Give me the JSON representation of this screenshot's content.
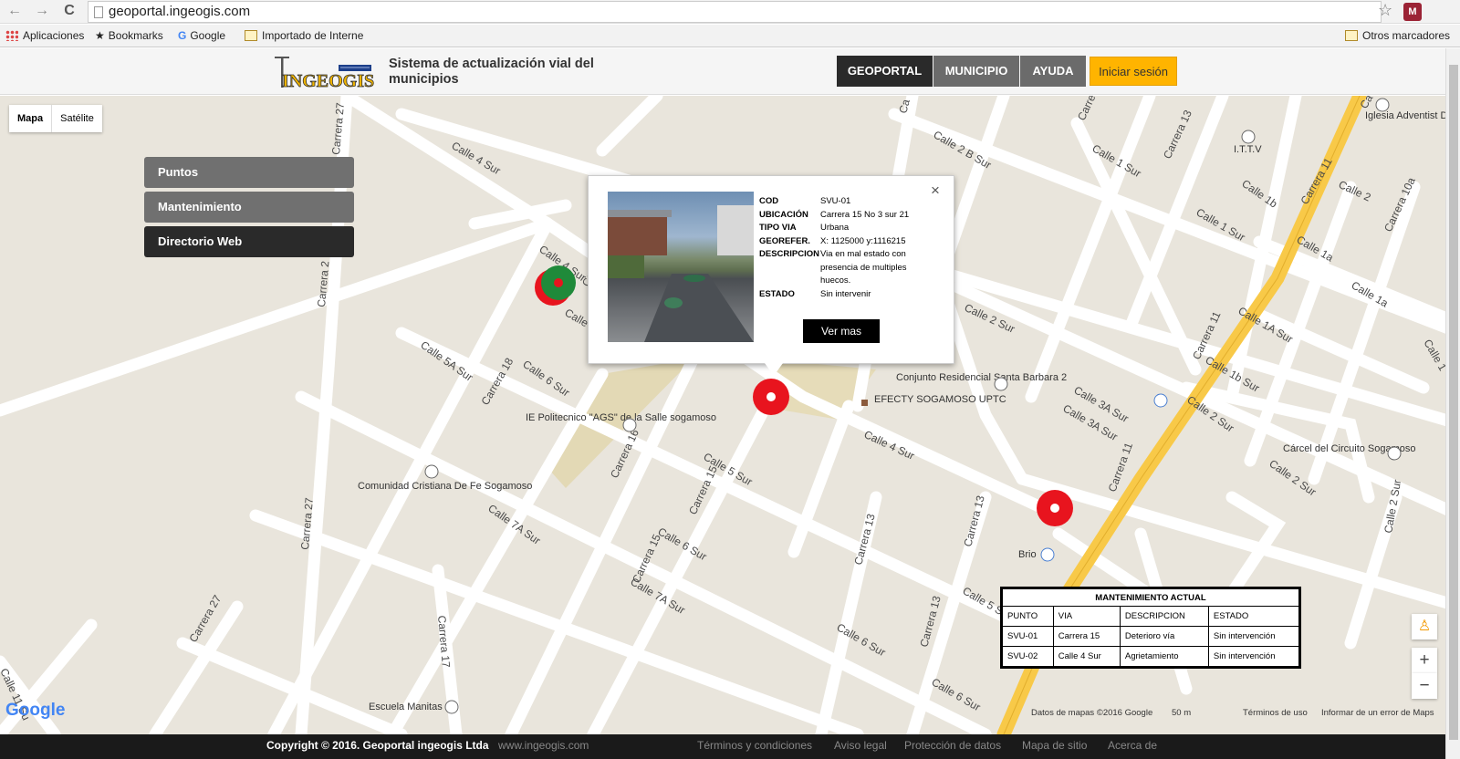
{
  "browser": {
    "url": "geoportal.ingeogis.com",
    "back": "←",
    "forward": "→",
    "reload": "C",
    "star": "☆",
    "ext": "M",
    "bookmarks": [
      "Aplicaciones",
      "Bookmarks",
      "Google",
      "Importado de Interne",
      "Otros marcadores"
    ]
  },
  "header": {
    "logo_text": "INGEOGIS",
    "title": "Sistema de actualización vial del municipios",
    "menu": [
      "GEOPORTAL",
      "MUNICIPIO",
      "AYUDA"
    ],
    "login": "Iniciar sesión"
  },
  "map": {
    "type_buttons": [
      "Mapa",
      "Satélite"
    ],
    "side_menu": [
      "Puntos",
      "Mantenimiento",
      "Directorio Web"
    ],
    "street_labels": [
      "Calle 4 Sur",
      "Carrera 27",
      "Carrera 2",
      "Calle 5A Sur",
      "Carrera 18",
      "Calle 6 Sur",
      "Calle 4 Sur",
      "Carrera 27",
      "Calle 7A Sur",
      "Carrera 16",
      "Calle 5 Sur",
      "Carrera 15",
      "Carrera 15",
      "Calle 6 Sur",
      "Calle 7A Sur",
      "Carrera 17",
      "Carrera 27",
      "Calle 11 Su",
      "Carrera 13",
      "Carrera 13",
      "Carrera 13",
      "Calle 6 Sur",
      "Calle 6 Sur",
      "Calle 5 S",
      "Calle 4 Sur",
      "Calle 3A Sur",
      "Calle 3A Sur",
      "Calle 2 Sur",
      "Calle 2 Sur",
      "Calle 1A Sur",
      "Calle 1b Sur",
      "Calle 2 Sur",
      "Carrera 11",
      "Carrera 11",
      "Carrera 11",
      "Calle 2 B Sur",
      "Calle 1 Sur",
      "Calle 1 Sur",
      "Carrera 13",
      "Calle 1b",
      "Calle 2",
      "Calle 1a",
      "Calle 1a",
      "Carrera 10a",
      "Calle 2 Sur",
      "Calle 1",
      "Ca",
      "Ca",
      "Calle",
      "Carrera",
      "Carrera"
    ],
    "places": {
      "ie": "IE Politecnico \"AGS\" de la Salle sogamoso",
      "comunidad": "Comunidad Cristiana De Fe Sogamoso",
      "conjunto": "Conjunto Residencial Santa Barbara 2",
      "efecty": "EFECTY SOGAMOSO UPTC",
      "carcel": "Cárcel del Circuito Sogamoso",
      "iglesia": "Iglesia Adventist Del Septimo Dia",
      "ittv": "I.T.T.V",
      "escuela": "Escuela Manitas",
      "brio": "Brio"
    },
    "attribution": [
      "Datos de mapas ©2016 Google",
      "50 m",
      "Términos de uso",
      "Informar de un error de Maps"
    ],
    "google_logo": "Google",
    "zoom_in": "+",
    "zoom_out": "−"
  },
  "popup": {
    "close": "×",
    "rows": [
      {
        "key": "COD",
        "val": "SVU-01"
      },
      {
        "key": "UBICACIÓN",
        "val": "Carrera 15 No 3 sur 21"
      },
      {
        "key": "TIPO VIA",
        "val": "Urbana"
      },
      {
        "key": "GEOREFER.",
        "val": "X: 1125000    y:1116215"
      },
      {
        "key": "DESCRIPCION",
        "val": "Via en mal estado con presencia de multiples huecos."
      },
      {
        "key": "ESTADO",
        "val": "Sin intervenir"
      }
    ],
    "button": "Ver mas"
  },
  "maint_table": {
    "title": "MANTENIMIENTO ACTUAL",
    "headers": [
      "PUNTO",
      "VIA",
      "DESCRIPCION",
      "ESTADO"
    ],
    "rows": [
      [
        "SVU-01",
        "Carrera 15",
        "Deterioro vía",
        "Sin intervención"
      ],
      [
        "SVU-02",
        "Calle 4 Sur",
        "Agrietamiento",
        "Sin intervención"
      ]
    ]
  },
  "footer": {
    "copyright": "Copyright © 2016. Geoportal ingeogis Ltda",
    "site": "www.ingeogis.com",
    "links": [
      "Términos y condiciones",
      "Aviso legal",
      "Protección de datos",
      "Mapa de sitio",
      "Acerca de"
    ]
  },
  "colors": {
    "marker_red": "#e8141e",
    "marker_green": "#1f8a3a",
    "highway": "#f8c948",
    "dark_btn": "#2a2a2a",
    "login": "#ffb400"
  }
}
